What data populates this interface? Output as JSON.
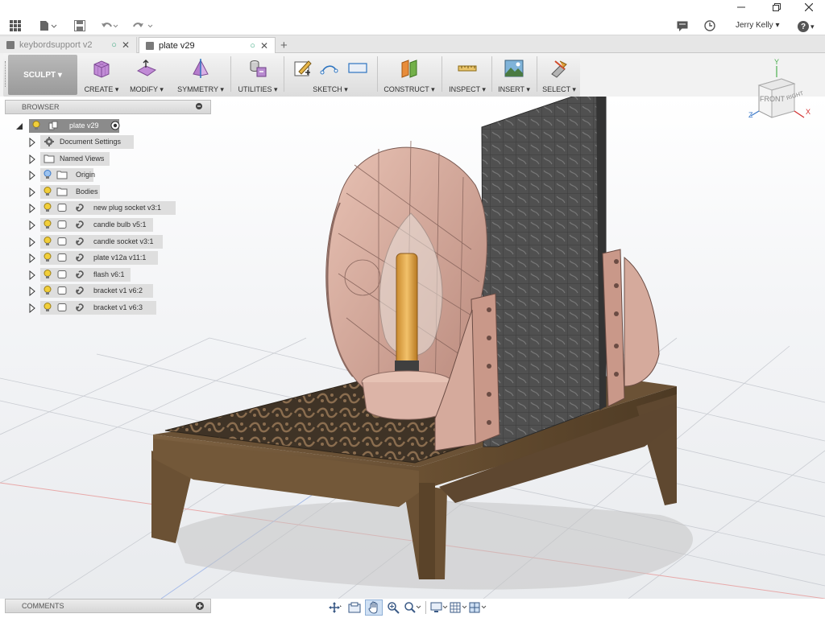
{
  "titlebar": {
    "user_name": "Jerry Kelly ▾",
    "help_label": "?",
    "icons": [
      "grid-icon",
      "file-icon",
      "save-icon",
      "undo-icon",
      "redo-icon",
      "comment-icon",
      "clock-icon"
    ]
  },
  "tabs": [
    {
      "label": "keybordsupport v2",
      "active": false
    },
    {
      "label": "plate v29",
      "active": true
    }
  ],
  "toolbar": {
    "workspace": "SCULPT ▾",
    "groups": [
      "CREATE ▾",
      "MODIFY ▾",
      "SYMMETRY ▾",
      "UTILITIES ▾",
      "SKETCH ▾",
      "CONSTRUCT ▾",
      "INSPECT ▾",
      "INSERT ▾",
      "SELECT ▾"
    ]
  },
  "browser": {
    "title": "BROWSER",
    "root": "plate v29",
    "items": [
      {
        "label": "Document Settings",
        "icon": "gear-icon"
      },
      {
        "label": "Named Views",
        "icon": "folder-icon"
      },
      {
        "label": "Origin",
        "icon": "folder-icon"
      },
      {
        "label": "Bodies",
        "icon": "folder-icon"
      },
      {
        "label": "new plug socket v3:1",
        "icon": "component-link-icon"
      },
      {
        "label": "candle bulb v5:1",
        "icon": "component-link-icon"
      },
      {
        "label": "candle socket v3:1",
        "icon": "component-link-icon"
      },
      {
        "label": "plate v12a v11:1",
        "icon": "component-link-icon"
      },
      {
        "label": "flash v6:1",
        "icon": "component-icon"
      },
      {
        "label": "bracket v1 v6:2",
        "icon": "component-link-icon"
      },
      {
        "label": "bracket v1 v6:3",
        "icon": "component-link-icon"
      }
    ]
  },
  "comments": {
    "title": "COMMENTS"
  },
  "viewcube": {
    "front": "FRONT",
    "right": "RIGHT",
    "axis_x": "X",
    "axis_y": "Y",
    "axis_z": "Z"
  },
  "colors": {
    "accent_blue": "#3a78c8",
    "wood": "#6e5436",
    "pink_part": "#d7a79b",
    "plate_dark": "#4b4b4b"
  }
}
